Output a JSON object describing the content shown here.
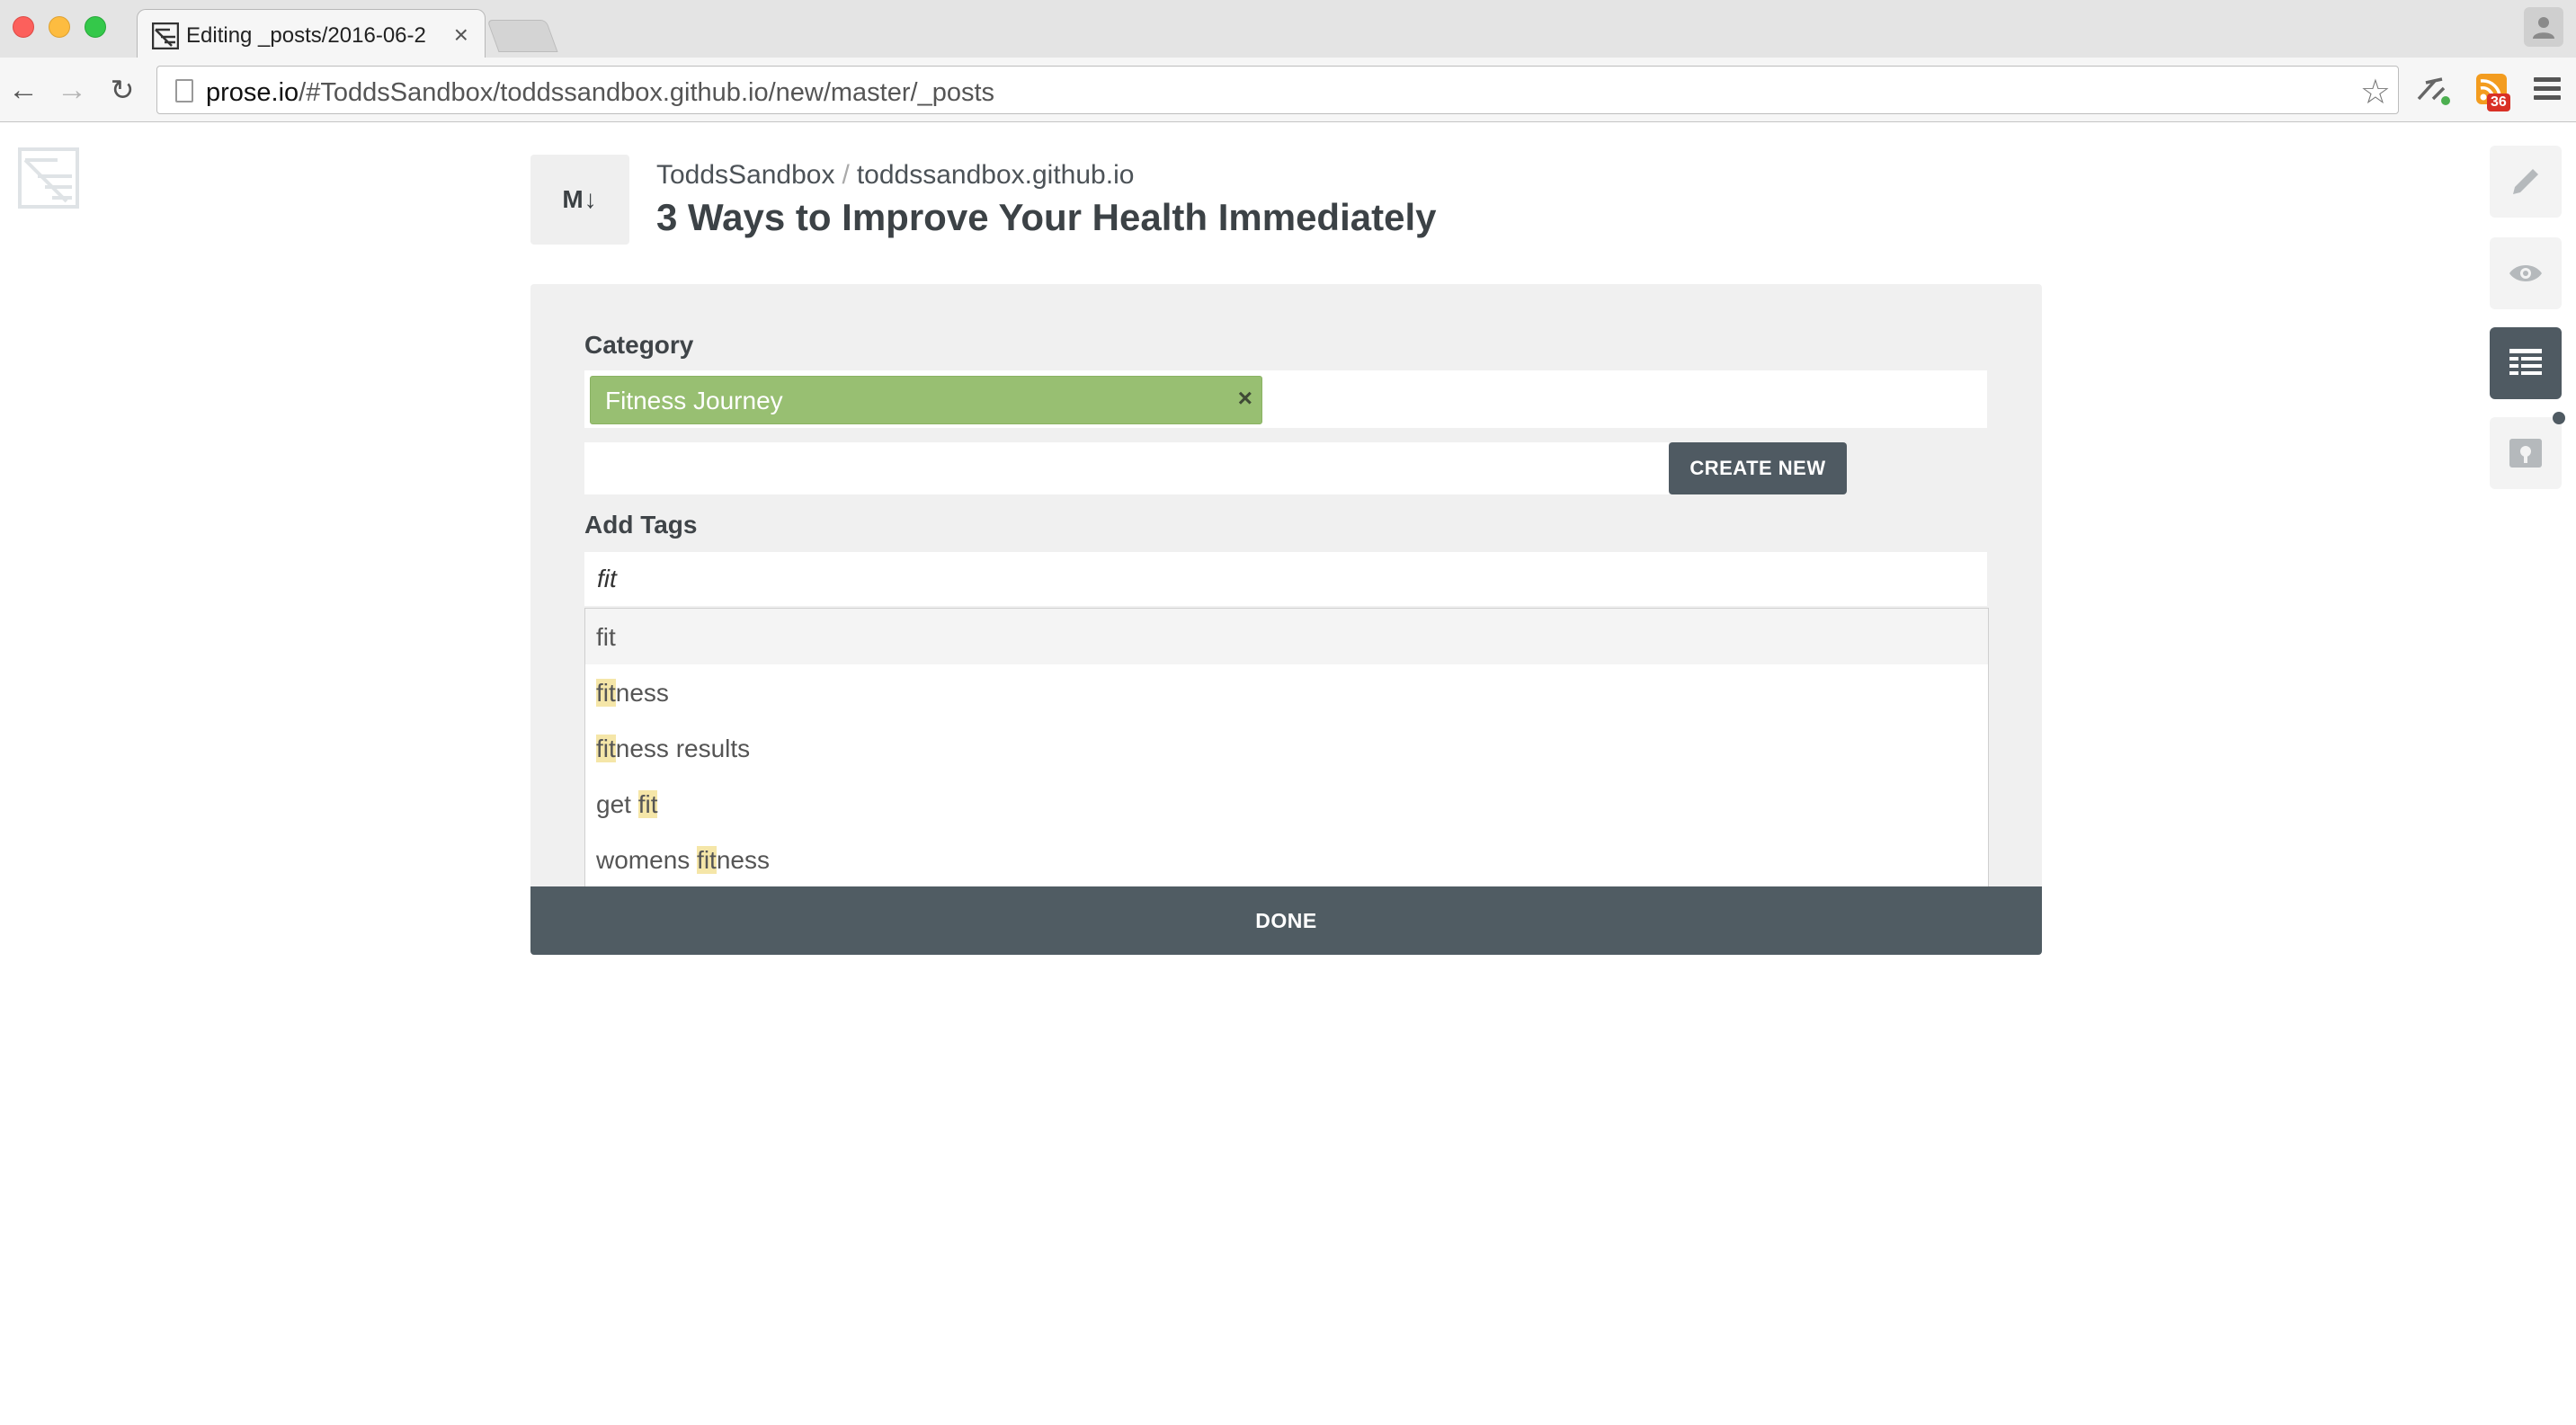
{
  "browser": {
    "tab_title": "Editing _posts/2016-06-2",
    "tab_close": "×",
    "url_host": "prose.io",
    "url_path": "/#ToddsSandbox/toddssandbox.github.io/new/master/_posts",
    "extension_badge": "36",
    "icons": [
      "back-arrow-icon",
      "forward-arrow-icon",
      "reload-icon",
      "page-icon",
      "star-icon",
      "extension-icon",
      "rss-icon",
      "menu-icon",
      "profile-icon"
    ]
  },
  "breadcrumb": {
    "owner": "ToddsSandbox",
    "separator": "/",
    "repo": "toddssandbox.github.io"
  },
  "file_type_badge": "M↓",
  "page_title": "3 Ways to Improve Your Health Immediately",
  "metadata": {
    "category_label": "Category",
    "selected_category": "Fitness Journey",
    "chip_remove": "×",
    "create_new_label": "CREATE NEW",
    "tags_label": "Add Tags",
    "tags_input_value": "fit",
    "suggestions": [
      {
        "pre": "",
        "match": "",
        "post": "fit"
      },
      {
        "pre": "",
        "match": "fit",
        "post": "ness"
      },
      {
        "pre": "",
        "match": "fit",
        "post": "ness results"
      },
      {
        "pre": "get ",
        "match": "fit",
        "post": ""
      },
      {
        "pre": "womens ",
        "match": "fit",
        "post": "ness"
      }
    ],
    "done_label": "DONE"
  },
  "colors": {
    "chip_green": "#98bf72",
    "dark_slate": "#4f5a62",
    "highlight": "#f5e6a8"
  }
}
